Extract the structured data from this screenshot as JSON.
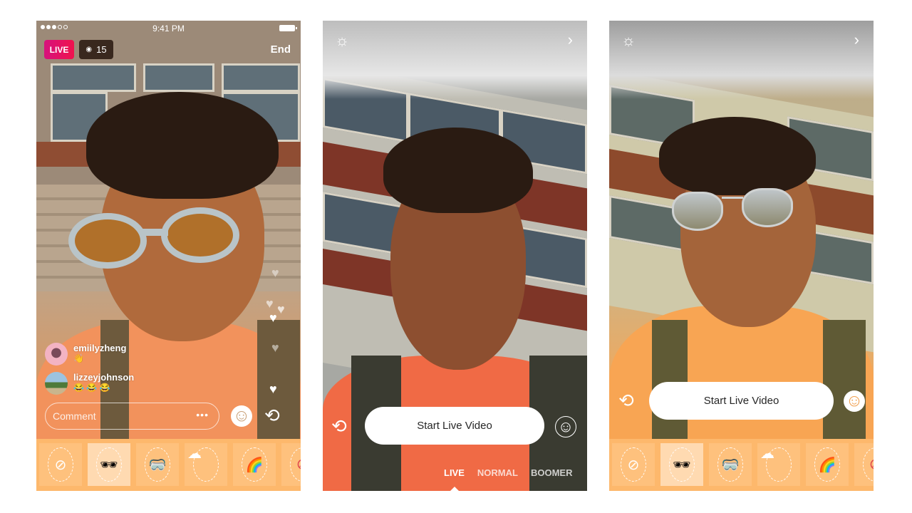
{
  "panels": {
    "live_broadcast": {
      "status_bar": {
        "time": "9:41 PM",
        "signal_filled": 3,
        "signal_total": 5
      },
      "live_badge": "LIVE",
      "viewer_count": "15",
      "end_label": "End",
      "comments": [
        {
          "username": "emiilyzheng",
          "text": "👋"
        },
        {
          "username": "lizzeyjohnson",
          "text": "😂 😂 😂"
        }
      ],
      "comment_placeholder": "Comment",
      "more_label": "•••",
      "hearts_count": 5
    },
    "live_camera": {
      "start_button": "Start Live Video",
      "modes": [
        "LIVE",
        "NORMAL",
        "BOOMER"
      ],
      "active_mode": "LIVE"
    },
    "live_camera_filter": {
      "start_button": "Start Live Video"
    }
  },
  "filters": [
    {
      "name": "none",
      "glyph": "⊘",
      "selected": false
    },
    {
      "name": "aviator-sunglasses",
      "glyph": "🕶",
      "selected": true
    },
    {
      "name": "moto-goggles",
      "glyph": "🥽",
      "selected": false
    },
    {
      "name": "cloud",
      "glyph": "☁",
      "selected": false
    },
    {
      "name": "rainbow",
      "glyph": "🌈",
      "selected": false
    },
    {
      "name": "peace",
      "glyph": "☮",
      "selected": false
    }
  ],
  "icons": {
    "gear": "☼",
    "chevron": "›",
    "flip": "⟲",
    "heart": "♥",
    "eye": "👁",
    "face": "☺"
  },
  "colors": {
    "live_gradient_start": "#d6127d",
    "live_gradient_end": "#f0134d",
    "tray": "#fdb86c"
  }
}
